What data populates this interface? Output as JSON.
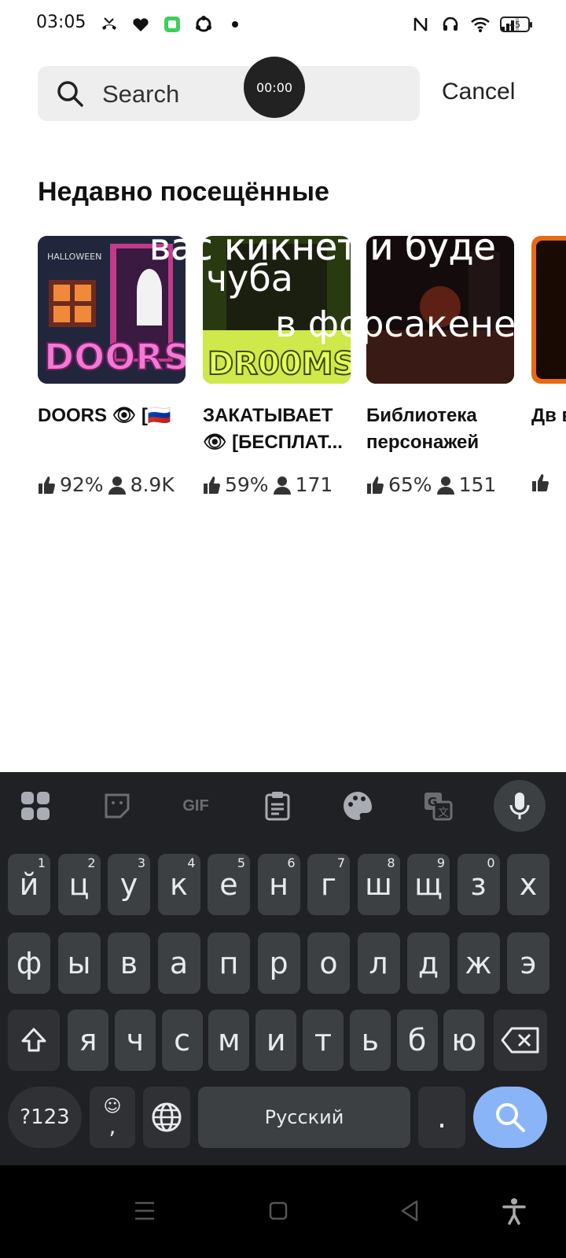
{
  "status_bar": {
    "time": "03:05",
    "battery": "45"
  },
  "search": {
    "placeholder": "Search",
    "cancel_label": "Cancel",
    "timer": "00:00"
  },
  "recent": {
    "title": "Недавно посещённые",
    "cards": [
      {
        "title": "DOORS 👁 [🇷🇺",
        "likes": "92%",
        "players": "8.9K",
        "thumb_text": "DOORS",
        "thumb_sub": "HALLOWEEN"
      },
      {
        "title": "ЗАКАТЫВАЕТ 👁 [БЕСПЛАТ...",
        "likes": "59%",
        "players": "171",
        "thumb_text": "DR00MS"
      },
      {
        "title": "Библиотека персонажей",
        "likes": "65%",
        "players": "151"
      },
      {
        "title": "Дв во",
        "likes": "",
        "players": ""
      }
    ]
  },
  "keyboard": {
    "row1": [
      {
        "k": "й",
        "h": "1"
      },
      {
        "k": "ц",
        "h": "2"
      },
      {
        "k": "у",
        "h": "3"
      },
      {
        "k": "к",
        "h": "4"
      },
      {
        "k": "е",
        "h": "5"
      },
      {
        "k": "н",
        "h": "6"
      },
      {
        "k": "г",
        "h": "7"
      },
      {
        "k": "ш",
        "h": "8"
      },
      {
        "k": "щ",
        "h": "9"
      },
      {
        "k": "з",
        "h": "0"
      },
      {
        "k": "х",
        "h": ""
      }
    ],
    "row2": [
      "ф",
      "ы",
      "в",
      "а",
      "п",
      "р",
      "о",
      "л",
      "д",
      "ж",
      "э"
    ],
    "row3": [
      "я",
      "ч",
      "с",
      "м",
      "и",
      "т",
      "ь",
      "б",
      "ю"
    ],
    "symbols_label": "?123",
    "comma_label": ",",
    "emoji_glyph": "☺",
    "space_label": "Русский",
    "period_label": ".",
    "gif_label": "GIF"
  },
  "overlay_text": {
    "line1": "вас кикнет и буде",
    "line2": "чуба",
    "line3": "в форсакене"
  },
  "colors": {
    "keyboard_bg": "#202124",
    "key_bg": "#3c4043",
    "search_key": "#8ab4f8"
  }
}
